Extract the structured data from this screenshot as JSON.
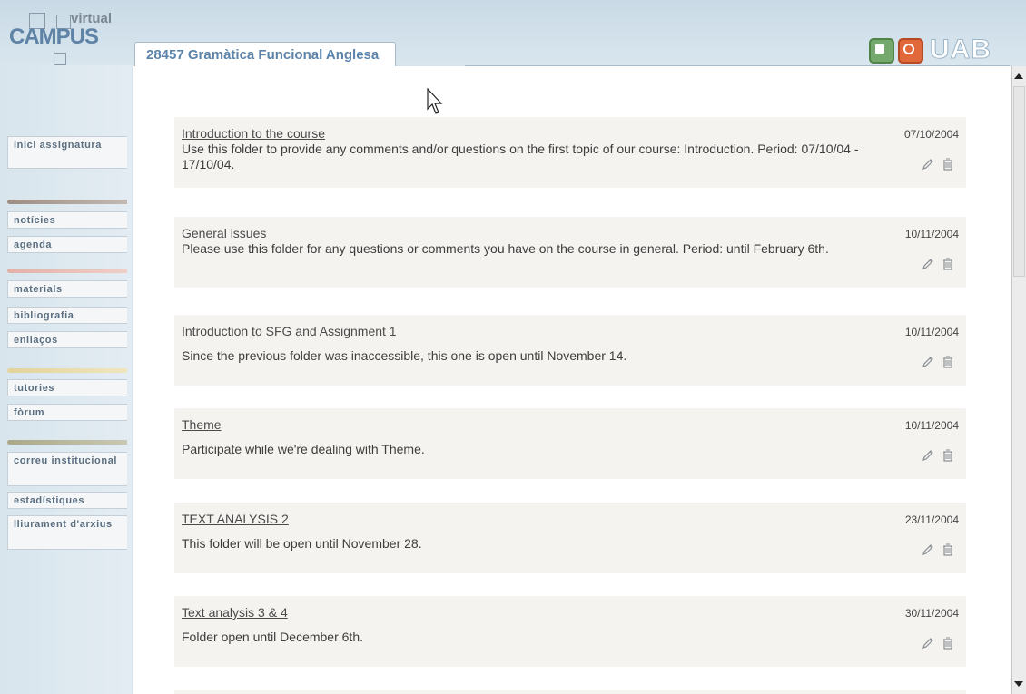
{
  "logo": {
    "virtual": "virtual",
    "campus": "CAMPUS"
  },
  "course_tab": "28457 Gramàtica Funcional Anglesa",
  "brand": "UAB",
  "sidebar": {
    "items": [
      {
        "label": "inici assignatura"
      },
      {
        "label": "notícies"
      },
      {
        "label": "agenda"
      },
      {
        "label": "materials"
      },
      {
        "label": "bibliografia"
      },
      {
        "label": "enllaços"
      },
      {
        "label": "tutories"
      },
      {
        "label": "fòrum"
      },
      {
        "label": "correu institucional"
      },
      {
        "label": "estadístiques"
      },
      {
        "label": "lliurament d'arxius"
      }
    ],
    "separator_colors": [
      "#9e8e84",
      "#e3b0a8",
      "#e2d39a",
      "#aaa888"
    ]
  },
  "folders": [
    {
      "title": "Introduction to the course",
      "date": "07/10/2004",
      "description": "Use this folder to provide any comments and/or questions on the first topic of our course: Introduction. Period: 07/10/04 - 17/10/04."
    },
    {
      "title": "General issues",
      "date": "10/11/2004",
      "description": "Please use this folder for any questions or comments you have on the course in general. Period: until February 6th."
    },
    {
      "title": "Introduction to SFG and Assignment 1",
      "date": "10/11/2004",
      "description": "Since the previous folder was inaccessible, this one is open until November 14."
    },
    {
      "title": "Theme",
      "date": "10/11/2004",
      "description": "Participate while we're dealing with Theme."
    },
    {
      "title": "TEXT ANALYSIS 2",
      "date": "23/11/2004",
      "description": "This folder will be open until November 28."
    },
    {
      "title": "Text analysis 3 & 4",
      "date": "30/11/2004",
      "description": "Folder open until December 6th."
    }
  ],
  "colors": {
    "accent": "#5c84aa",
    "folder_bg": "#f5f3ef",
    "home_button": "#75a86c",
    "exit_button": "#e0683a"
  },
  "icons": [
    "home-icon",
    "exit-icon",
    "edit-icon",
    "trash-icon"
  ]
}
